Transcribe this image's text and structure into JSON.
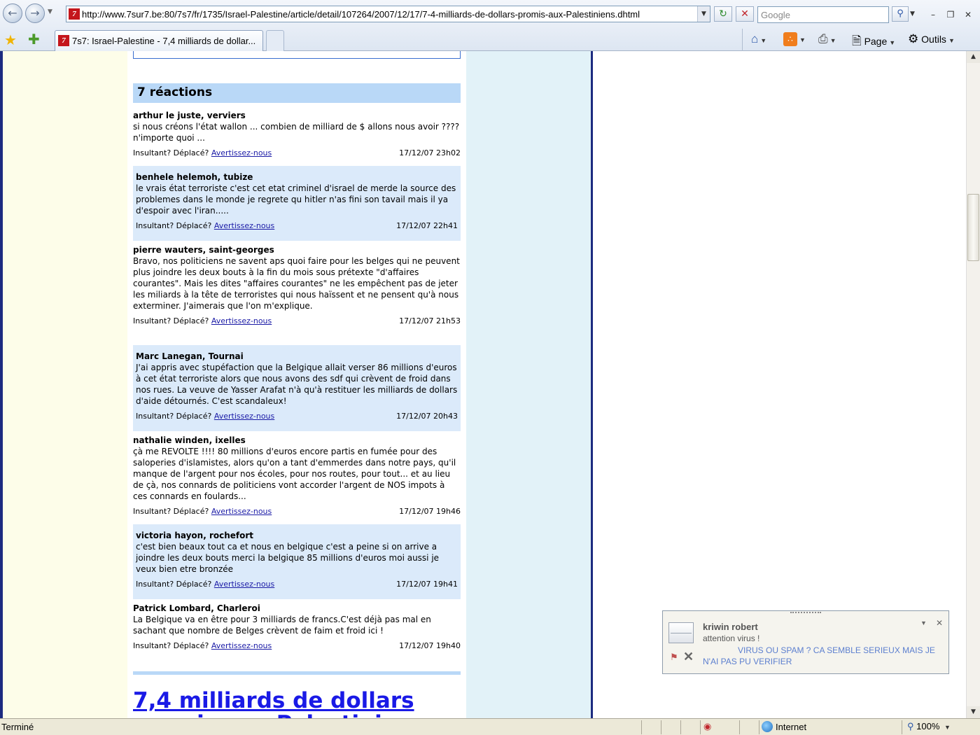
{
  "browser": {
    "url": "http://www.7sur7.be:80/7s7/fr/1735/Israel-Palestine/article/detail/107264/2007/12/17/7-4-milliards-de-dollars-promis-aux-Palestiniens.dhtml",
    "search_placeholder": "Google",
    "tab_title": "7s7: Israel-Palestine - 7,4 milliards de dollar...",
    "favicon_letter": "7",
    "tools": {
      "page": "Page",
      "outils": "Outils"
    }
  },
  "page": {
    "reactions_header": "7 réactions",
    "comments": [
      {
        "author": "arthur le juste, verviers",
        "text": "si nous créons l'état wallon ... combien de milliard de $ allons nous avoir ???? n'importe quoi ...",
        "meta_label": "Insultant? Déplacé?",
        "report_link": "Avertissez-nous",
        "date": "17/12/07 23h02"
      },
      {
        "author": "benhele helemoh, tubize",
        "text": "le vrais état terroriste c'est cet etat criminel d'israel de merde la source des problemes dans le monde je regrete qu hitler n'as fini son tavail mais il ya d'espoir avec l'iran.....",
        "meta_label": "Insultant? Déplacé?",
        "report_link": "Avertissez-nous",
        "date": "17/12/07 22h41"
      },
      {
        "author": "pierre wauters, saint-georges",
        "text": "Bravo, nos politiciens ne savent aps quoi faire pour les belges qui ne peuvent plus joindre les deux bouts à la fin du mois sous prétexte \"d'affaires courantes\". Mais les dites \"affaires courantes\" ne les empêchent pas de jeter les miliards à la tête de terroristes qui nous haïssent et ne pensent qu'à nous exterminer. J'aimerais que l'on m'explique.",
        "meta_label": "Insultant? Déplacé?",
        "report_link": "Avertissez-nous",
        "date": "17/12/07 21h53"
      },
      {
        "author": "Marc Lanegan, Tournai",
        "text": "J'ai appris avec stupéfaction que la Belgique allait verser 86 millions d'euros à cet état terroriste alors que nous avons des sdf qui crèvent de froid dans nos rues. La veuve de Yasser Arafat n'à qu'à restituer les milliards de dollars d'aide détournés. C'est scandaleux!",
        "meta_label": "Insultant? Déplacé?",
        "report_link": "Avertissez-nous",
        "date": "17/12/07 20h43"
      },
      {
        "author": "nathalie winden, ixelles",
        "text": "çà me REVOLTE !!!! 80 millions d'euros encore partis en fumée pour des saloperies d'islamistes, alors qu'on a tant d'emmerdes dans notre pays, qu'il manque de l'argent pour nos écoles, pour nos routes, pour tout... et au lieu de çà, nos connards de politiciens vont accorder l'argent de NOS impots à ces connards en foulards...",
        "meta_label": "Insultant? Déplacé?",
        "report_link": "Avertissez-nous",
        "date": "17/12/07 19h46"
      },
      {
        "author": "victoria hayon, rochefort",
        "text": "c'est bien beaux tout ca et nous en belgique c'est a peine si on arrive a joindre les deux bouts merci la belgique 85 millions d'euros moi aussi je veux bien etre bronzée",
        "meta_label": "Insultant? Déplacé?",
        "report_link": "Avertissez-nous",
        "date": "17/12/07 19h41"
      },
      {
        "author": "Patrick Lombard, Charleroi",
        "text": "La Belgique va en être pour 3 milliards de francs.C'est déjà pas mal en sachant que nombre de Belges crèvent de faim et froid ici !",
        "meta_label": "Insultant? Déplacé?",
        "report_link": "Avertissez-nous",
        "date": "17/12/07 19h40"
      }
    ],
    "next_article_title": "7,4 milliards de dollars",
    "next_article_title_line2": "promis aux Palestiniens"
  },
  "notification": {
    "from": "kriwin robert",
    "subject": "attention virus !",
    "body": "VIRUS OU SPAM ? CA SEMBLE SERIEUX MAIS JE N'AI PAS PU VERIFIER"
  },
  "statusbar": {
    "status": "Terminé",
    "zone": "Internet",
    "zoom": "100%"
  },
  "colors": {
    "left_column": "#fdfde9",
    "right_column": "#e2f2f8",
    "divider": "#1c2b80",
    "reaction_header": "#b9d8f7",
    "alt_comment": "#dbeafa",
    "link": "#1a1aa6"
  }
}
